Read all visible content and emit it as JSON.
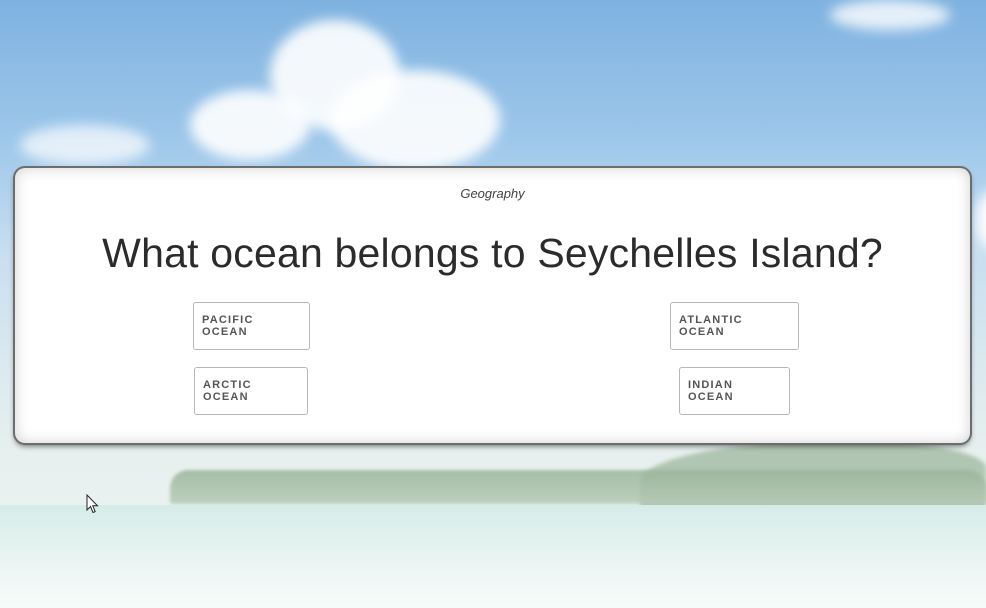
{
  "quiz": {
    "category": "Geography",
    "question": "What ocean belongs to Seychelles Island?",
    "answers": [
      "PACIFIC OCEAN",
      "ATLANTIC OCEAN",
      "ARCTIC OCEAN",
      "INDIAN OCEAN"
    ]
  },
  "icons": {
    "cursor": "mouse-pointer-icon"
  },
  "colors": {
    "card_background": "#ffffff",
    "sky": "#9cc6ea",
    "text": "#2b2b2b",
    "button_border": "#b7b7b7"
  }
}
